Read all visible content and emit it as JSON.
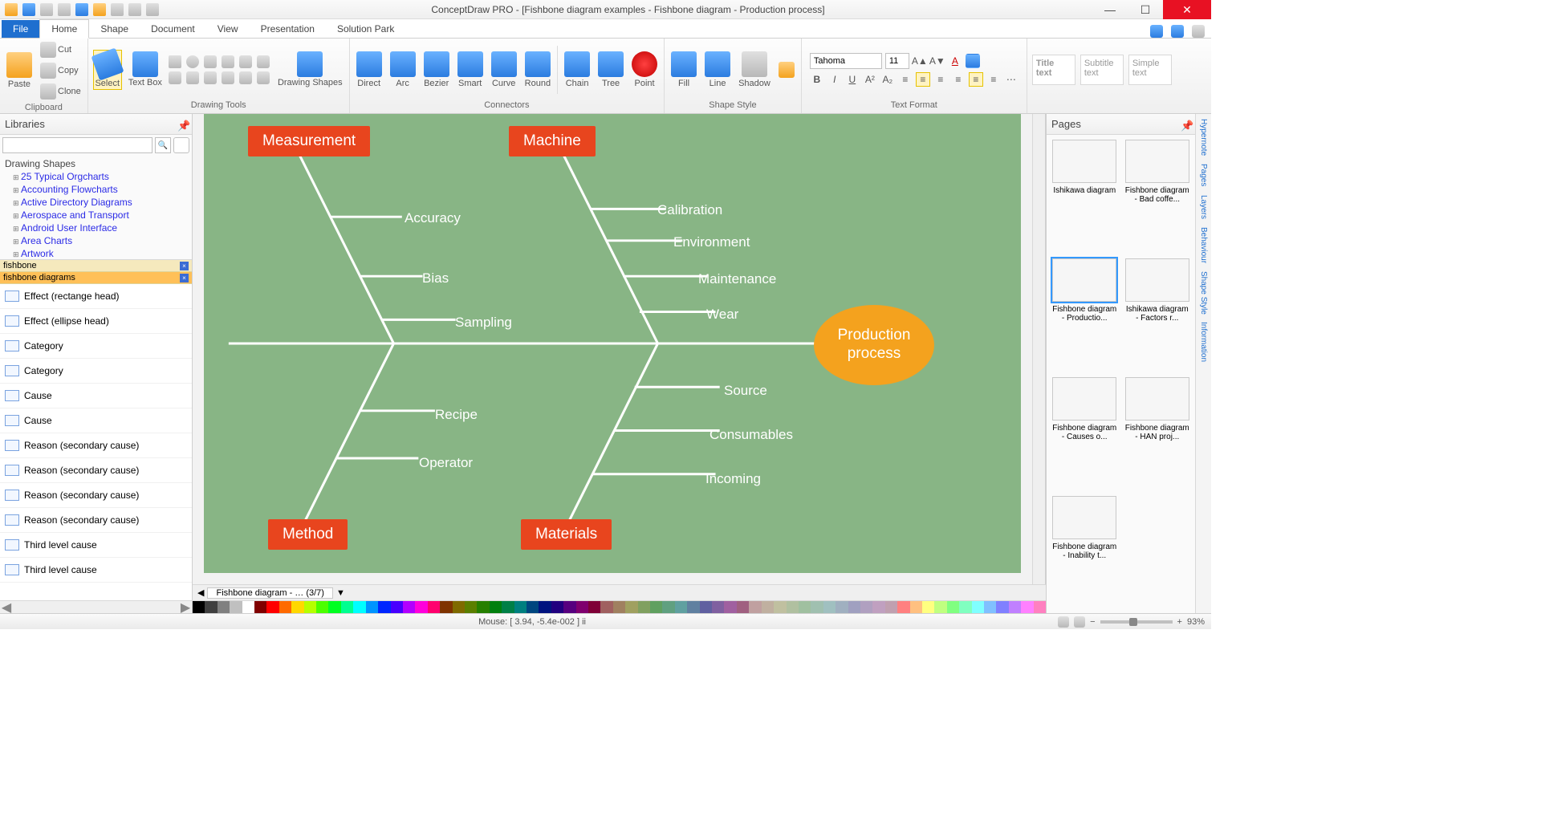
{
  "app_title": "ConceptDraw PRO - [Fishbone diagram examples - Fishbone diagram - Production process]",
  "tabs": {
    "file": "File",
    "home": "Home",
    "shape": "Shape",
    "document": "Document",
    "view": "View",
    "presentation": "Presentation",
    "solution": "Solution Park"
  },
  "ribbon": {
    "clipboard": {
      "paste": "Paste",
      "cut": "Cut",
      "copy": "Copy",
      "clone": "Clone",
      "label": "Clipboard"
    },
    "select": "Select",
    "textbox": "Text Box",
    "drawing_shapes": "Drawing Shapes",
    "drawing_label": "Drawing Tools",
    "conn": {
      "direct": "Direct",
      "arc": "Arc",
      "bezier": "Bezier",
      "smart": "Smart",
      "curve": "Curve",
      "round": "Round",
      "chain": "Chain",
      "tree": "Tree",
      "point": "Point",
      "label": "Connectors"
    },
    "style": {
      "fill": "Fill",
      "line": "Line",
      "shadow": "Shadow",
      "label": "Shape Style"
    },
    "text": {
      "font": "Tahoma",
      "size": "11",
      "label": "Text Format"
    },
    "boxes": {
      "title": "Title text",
      "subtitle": "Subtitle text",
      "simple": "Simple text"
    }
  },
  "left": {
    "title": "Libraries",
    "tree_hdr": "Drawing Shapes",
    "tree": [
      "25 Typical Orgcharts",
      "Accounting Flowcharts",
      "Active Directory Diagrams",
      "Aerospace and Transport",
      "Android User Interface",
      "Area Charts",
      "Artwork"
    ],
    "tab1": "fishbone",
    "tab2": "fishbone diagrams",
    "items": [
      "Effect (rectange head)",
      "Effect (ellipse head)",
      "Category",
      "Category",
      "Cause",
      "Cause",
      "Reason (secondary cause)",
      "Reason (secondary cause)",
      "Reason (secondary cause)",
      "Reason (secondary cause)",
      "Third level cause",
      "Third level cause"
    ]
  },
  "diagram": {
    "categories": {
      "measurement": "Measurement",
      "machine": "Machine",
      "method": "Method",
      "materials": "Materials"
    },
    "causes": {
      "measurement": [
        "Accuracy",
        "Bias",
        "Sampling"
      ],
      "machine": [
        "Calibration",
        "Environment",
        "Maintenance",
        "Wear"
      ],
      "method": [
        "Recipe",
        "Operator"
      ],
      "materials": [
        "Source",
        "Consumables",
        "Incoming"
      ]
    },
    "effect": "Production process"
  },
  "pagetab": "Fishbone diagram - … (3/7)",
  "right": {
    "title": "Pages",
    "thumbs": [
      "Ishikawa diagram",
      "Fishbone diagram - Bad coffe...",
      "Fishbone diagram - Productio...",
      "Ishikawa diagram - Factors r...",
      "Fishbone diagram - Causes o...",
      "Fishbone diagram - HAN proj...",
      "Fishbone diagram - Inability t..."
    ],
    "vtabs": [
      "Hypernote",
      "Pages",
      "Layers",
      "Behaviour",
      "Shape Style",
      "Information"
    ]
  },
  "status": {
    "mouse": "Mouse: [ 3.94, -5.4e-002 ] ii",
    "zoom": "93%"
  },
  "colors": [
    "#000000",
    "#404040",
    "#808080",
    "#c0c0c0",
    "#ffffff",
    "#800000",
    "#ff0000",
    "#ff6a00",
    "#ffd800",
    "#b6ff00",
    "#4cff00",
    "#00ff21",
    "#00ff90",
    "#00ffff",
    "#0094ff",
    "#0026ff",
    "#4800ff",
    "#b200ff",
    "#ff00dc",
    "#ff006e",
    "#7f3300",
    "#7f6a00",
    "#5b7f00",
    "#267f00",
    "#007f0e",
    "#007f46",
    "#007f7f",
    "#00467f",
    "#00137f",
    "#21007f",
    "#57007f",
    "#7f006e",
    "#7f0037",
    "#a06060",
    "#a08060",
    "#a0a060",
    "#80a060",
    "#60a060",
    "#60a080",
    "#60a0a0",
    "#6080a0",
    "#6060a0",
    "#8060a0",
    "#a060a0",
    "#a06080",
    "#c0a0a0",
    "#c0b0a0",
    "#c0c0a0",
    "#b0c0a0",
    "#a0c0a0",
    "#a0c0b0",
    "#a0c0c0",
    "#a0b0c0",
    "#a0a0c0",
    "#b0a0c0",
    "#c0a0c0",
    "#c0a0b0",
    "#ff8080",
    "#ffc080",
    "#ffff80",
    "#c0ff80",
    "#80ff80",
    "#80ffc0",
    "#80ffff",
    "#80c0ff",
    "#8080ff",
    "#c080ff",
    "#ff80ff",
    "#ff80c0"
  ]
}
